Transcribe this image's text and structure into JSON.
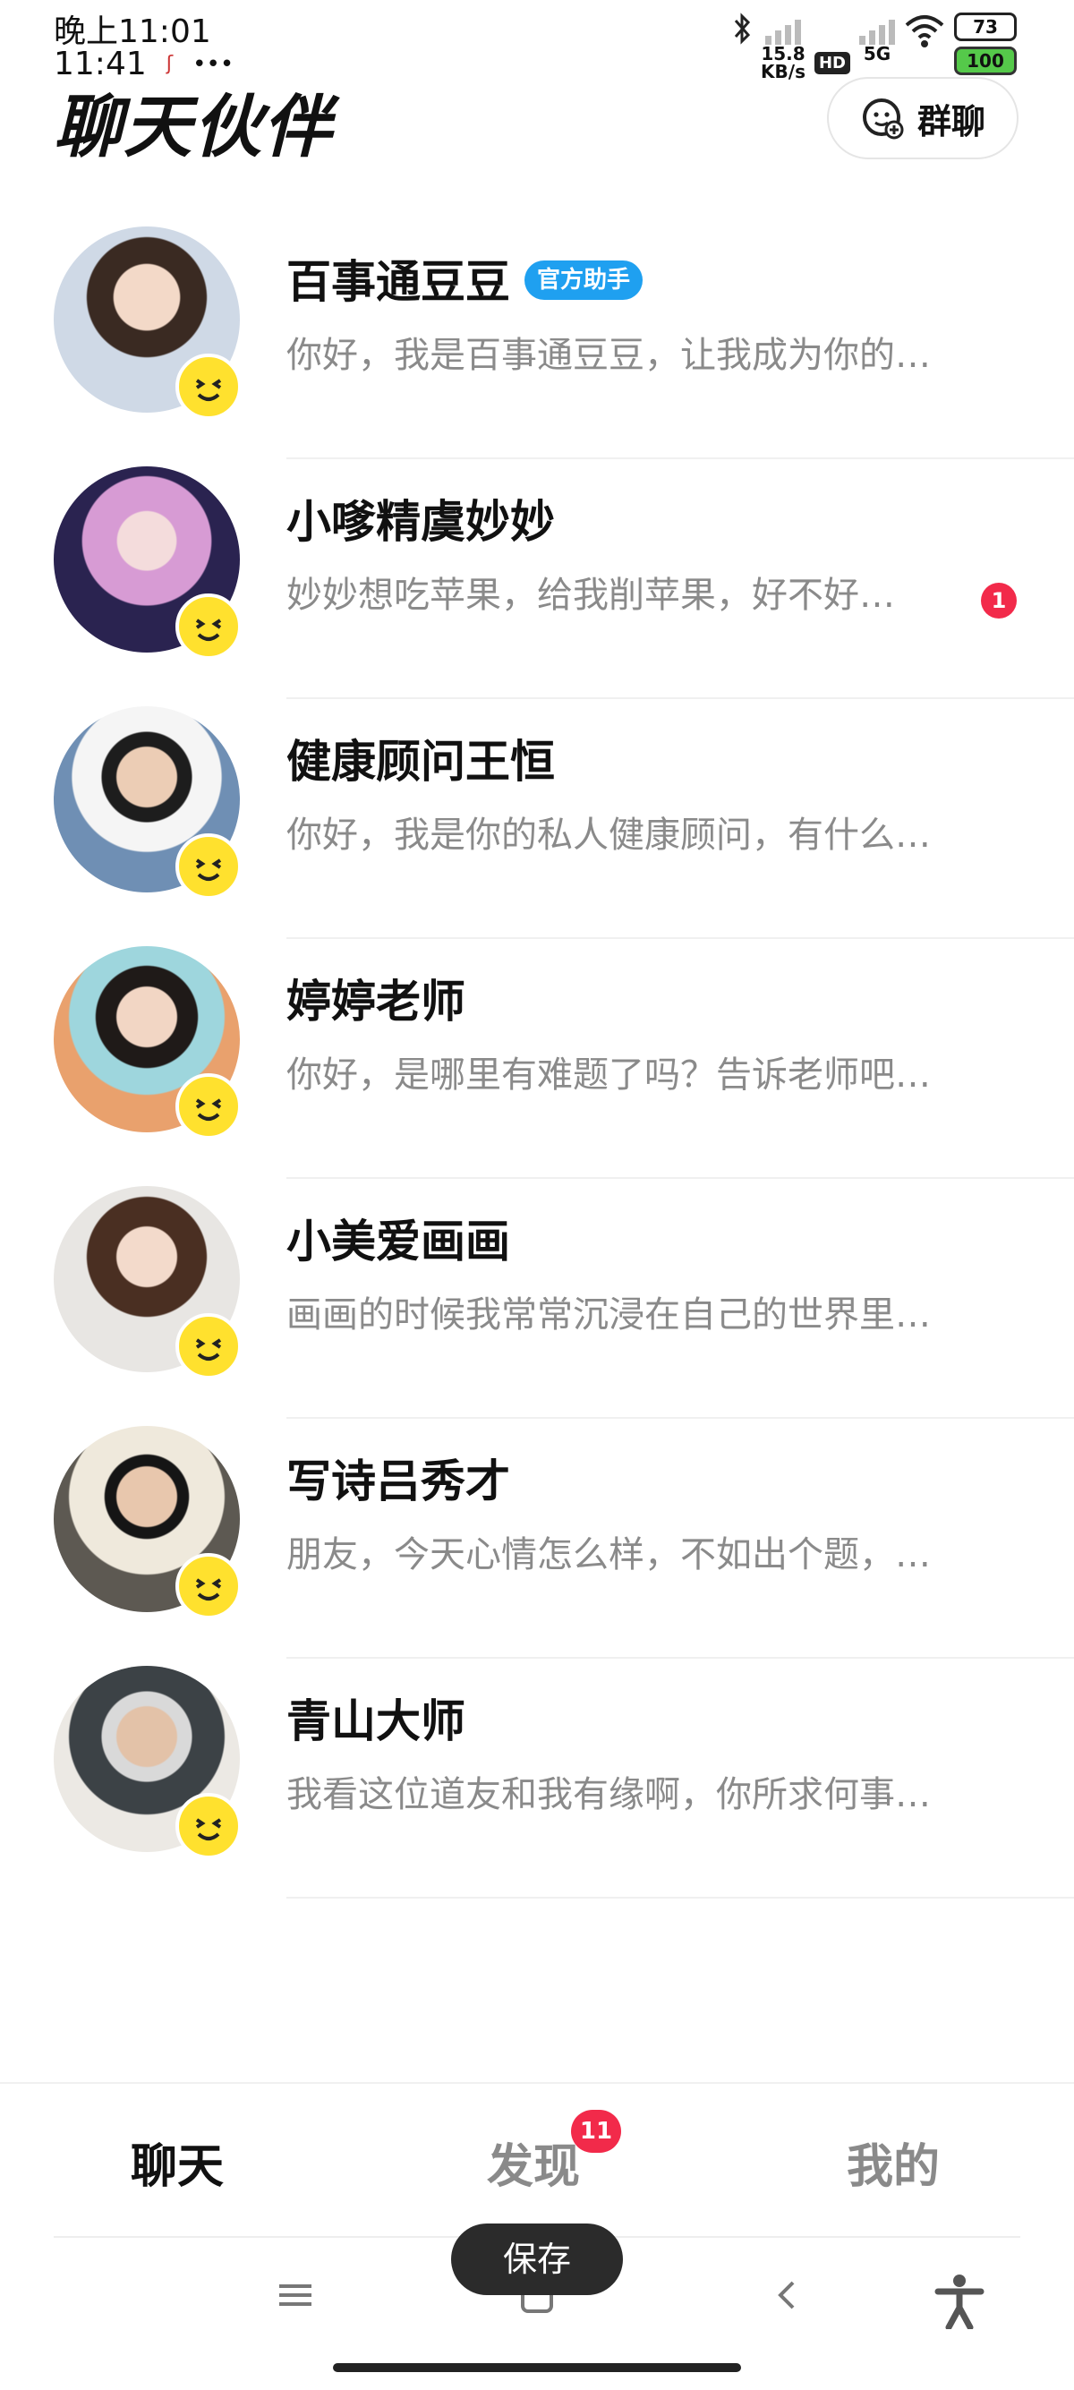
{
  "status_bar": {
    "time_line1": "晚上11:01",
    "time_line2": "11:41",
    "dots": "•••",
    "speed_value": "15.8",
    "speed_unit": "KB/s",
    "hd_label": "HD",
    "network_label": "5G",
    "battery_top": "73",
    "battery_bottom": "100"
  },
  "header": {
    "title": "聊天伙伴",
    "group_chat_label": "群聊"
  },
  "chats": [
    {
      "name": "百事通豆豆",
      "tag": "官方助手",
      "preview": "你好，我是百事通豆豆，让我成为你的…",
      "avatar_color": "#cfd9e6"
    },
    {
      "name": "小嗲精虞妙妙",
      "preview": "妙妙想吃苹果，给我削苹果，好不好…",
      "unread": "1",
      "avatar_color": "#7b4a9a"
    },
    {
      "name": "健康顾问王恒",
      "preview": "你好，我是你的私人健康顾问，有什么…",
      "avatar_color": "#6f8fb4"
    },
    {
      "name": "婷婷老师",
      "preview": "你好，是哪里有难题了吗？告诉老师吧…",
      "avatar_color": "#e9a16d"
    },
    {
      "name": "小美爱画画",
      "preview": "画画的时候我常常沉浸在自己的世界里…",
      "avatar_color": "#d8d4cf"
    },
    {
      "name": "写诗吕秀才",
      "preview": "朋友，今天心情怎么样，不如出个题，…",
      "avatar_color": "#5d5952"
    },
    {
      "name": "青山大师",
      "preview": "我看这位道友和我有缘啊，你所求何事…",
      "avatar_color": "#c7c4bf"
    }
  ],
  "tabs": [
    {
      "label": "聊天",
      "active": true
    },
    {
      "label": "发现",
      "badge": "11"
    },
    {
      "label": "我的"
    }
  ],
  "toast": {
    "label": "保存"
  },
  "colors": {
    "accent_blue": "#1fa0f0",
    "badge_red": "#f22a4a",
    "emoji_yellow": "#ffe12e"
  }
}
